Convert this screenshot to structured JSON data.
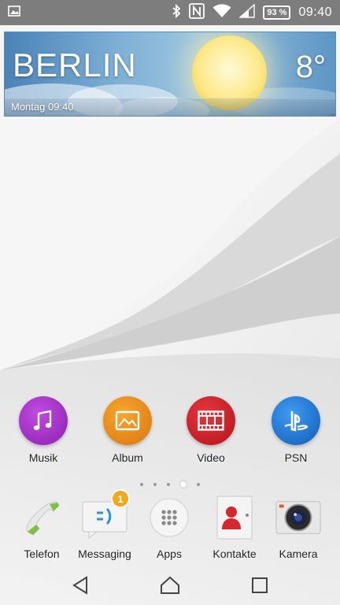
{
  "status_bar": {
    "battery": "93 %",
    "time": "09:40",
    "icons": [
      "gallery-icon",
      "bluetooth-icon",
      "nfc-icon",
      "wifi-icon",
      "signal-icon",
      "battery-icon"
    ]
  },
  "weather": {
    "city": "BERLIN",
    "temperature": "8°",
    "datetime": "Montag 09:40",
    "condition_icon": "sun-icon"
  },
  "home_apps": [
    {
      "label": "Musik",
      "icon": "music-note-icon",
      "color": "#a32ec4"
    },
    {
      "label": "Album",
      "icon": "photo-icon",
      "color": "#e68a12"
    },
    {
      "label": "Video",
      "icon": "film-icon",
      "color": "#d21f2a"
    },
    {
      "label": "PSN",
      "icon": "playstation-icon",
      "color": "#1e74d3"
    }
  ],
  "page_indicator": {
    "count": 5,
    "active_index": 3
  },
  "dock_apps": [
    {
      "label": "Telefon",
      "icon": "phone-icon"
    },
    {
      "label": "Messaging",
      "icon": "message-icon",
      "badge": "1"
    },
    {
      "label": "Apps",
      "icon": "apps-grid-icon"
    },
    {
      "label": "Kontakte",
      "icon": "contacts-icon"
    },
    {
      "label": "Kamera",
      "icon": "camera-icon"
    }
  ],
  "nav": [
    "back-icon",
    "home-icon",
    "recents-icon"
  ]
}
